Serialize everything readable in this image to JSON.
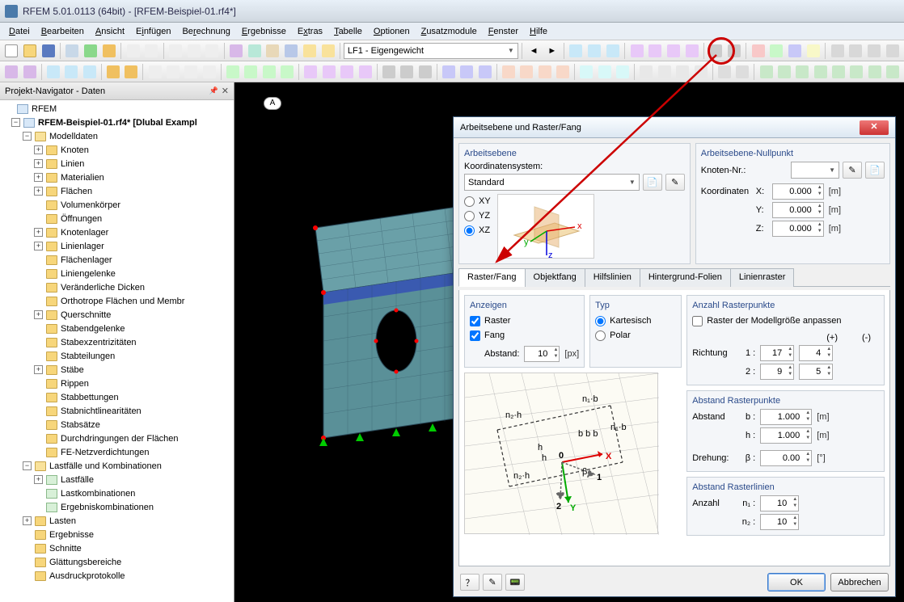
{
  "titlebar": {
    "text": "RFEM 5.01.0113 (64bit) - [RFEM-Beispiel-01.rf4*]"
  },
  "menu": [
    "Datei",
    "Bearbeiten",
    "Ansicht",
    "Einfügen",
    "Berechnung",
    "Ergebnisse",
    "Extras",
    "Tabelle",
    "Optionen",
    "Zusatzmodule",
    "Fenster",
    "Hilfe"
  ],
  "loadcase_combo": "LF1 - Eigengewicht",
  "sidebar": {
    "title": "Projekt-Navigator - Daten",
    "root": "RFEM",
    "file": "RFEM-Beispiel-01.rf4* [Dlubal Exampl",
    "modelldaten": "Modelldaten",
    "items": [
      "Knoten",
      "Linien",
      "Materialien",
      "Flächen",
      "Volumenkörper",
      "Öffnungen",
      "Knotenlager",
      "Linienlager",
      "Flächenlager",
      "Liniengelenke",
      "Veränderliche Dicken",
      "Orthotrope Flächen und Membr",
      "Querschnitte",
      "Stabendgelenke",
      "Stabexzentrizitäten",
      "Stabteilungen",
      "Stäbe",
      "Rippen",
      "Stabbettungen",
      "Stabnichtlinearitäten",
      "Stabsätze",
      "Durchdringungen der Flächen",
      "FE-Netzverdichtungen"
    ],
    "lastf": "Lastfälle und Kombinationen",
    "lastf_items": [
      "Lastfälle",
      "Lastkombinationen",
      "Ergebniskombinationen"
    ],
    "tail": [
      "Lasten",
      "Ergebnisse",
      "Schnitte",
      "Glättungsbereiche",
      "Ausdruckprotokolle"
    ]
  },
  "viewport": {
    "badge": "A"
  },
  "dialog": {
    "title": "Arbeitsebene und Raster/Fang",
    "arbeitsebene": {
      "title": "Arbeitsebene",
      "coord_label": "Koordinatensystem:",
      "coord_value": "Standard",
      "planes": [
        "XY",
        "YZ",
        "XZ"
      ],
      "plane_selected": "XZ"
    },
    "nullpunkt": {
      "title": "Arbeitsebene-Nullpunkt",
      "knoten_label": "Knoten-Nr.:",
      "knoten_value": "",
      "coords_label": "Koordinaten",
      "x": "0.000",
      "y": "0.000",
      "z": "0.000",
      "unit": "[m]"
    },
    "tabs": [
      "Raster/Fang",
      "Objektfang",
      "Hilfslinien",
      "Hintergrund-Folien",
      "Linienraster"
    ],
    "active_tab": "Raster/Fang",
    "anzeigen": {
      "title": "Anzeigen",
      "raster": "Raster",
      "raster_checked": true,
      "fang": "Fang",
      "fang_checked": true,
      "abstand_label": "Abstand:",
      "abstand_value": "10",
      "abstand_unit": "[px]"
    },
    "typ": {
      "title": "Typ",
      "kartesisch": "Kartesisch",
      "kartesisch_sel": true,
      "polar": "Polar"
    },
    "anzahl": {
      "title": "Anzahl Rasterpunkte",
      "fit": "Raster der Modellgröße anpassen",
      "plus": "(+)",
      "minus": "(-)",
      "richtung": "Richtung",
      "r1": "1 :",
      "v1": "17",
      "v1m": "4",
      "r2": "2 :",
      "v2": "9",
      "v2m": "5"
    },
    "abstand": {
      "title": "Abstand Rasterpunkte",
      "lab": "Abstand",
      "b": "b :",
      "bv": "1.000",
      "bu": "[m]",
      "h": "h :",
      "hv": "1.000",
      "hu": "[m]",
      "drehung": "Drehung:",
      "beta": "β :",
      "dv": "0.00",
      "du": "[°]"
    },
    "linien": {
      "title": "Abstand Rasterlinien",
      "anz": "Anzahl",
      "n1": "n₁ :",
      "n1v": "10",
      "n2": "n₂ :",
      "n2v": "10"
    },
    "buttons": {
      "ok": "OK",
      "cancel": "Abbrechen"
    }
  }
}
